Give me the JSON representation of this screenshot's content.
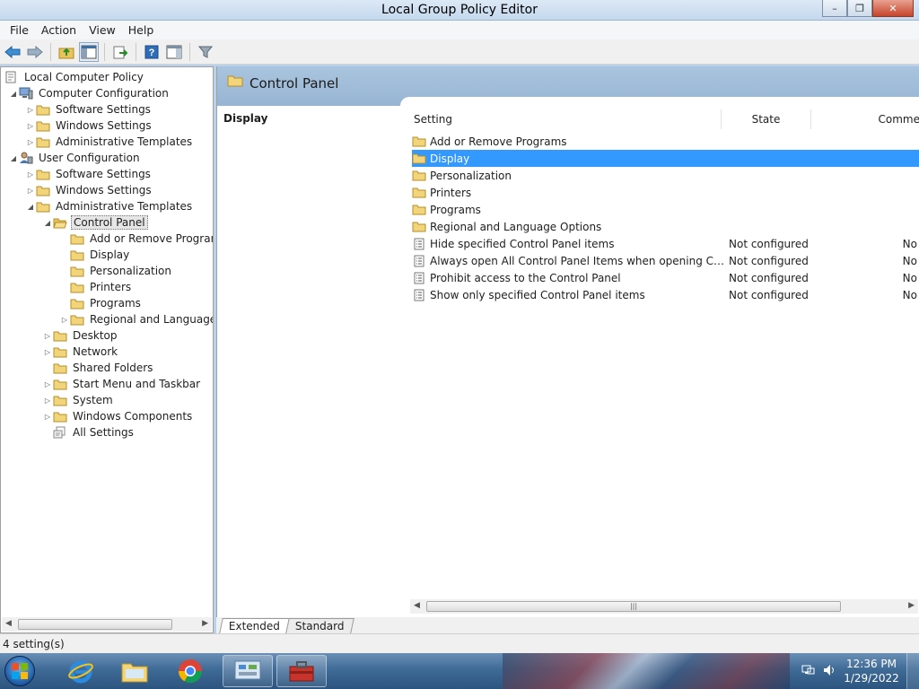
{
  "window": {
    "title": "Local Group Policy Editor",
    "minimize": "–",
    "restore": "❐",
    "close": "✕"
  },
  "menu": [
    "File",
    "Action",
    "View",
    "Help"
  ],
  "toolbar": {
    "icons": [
      "back-arrow-icon",
      "forward-arrow-icon",
      "up-folder-icon",
      "show-hide-tree-icon",
      "export-list-icon",
      "help-icon",
      "properties-pane-icon",
      "filter-icon"
    ]
  },
  "tree": [
    {
      "label": "Local Computer Policy",
      "level": 0,
      "expander": "",
      "icon": "policy"
    },
    {
      "label": "Computer Configuration",
      "level": 1,
      "expander": "◢",
      "icon": "computer"
    },
    {
      "label": "Software Settings",
      "level": 2,
      "expander": "▷",
      "icon": "folder"
    },
    {
      "label": "Windows Settings",
      "level": 2,
      "expander": "▷",
      "icon": "folder"
    },
    {
      "label": "Administrative Templates",
      "level": 2,
      "expander": "▷",
      "icon": "folder"
    },
    {
      "label": "User Configuration",
      "level": 1,
      "expander": "◢",
      "icon": "user"
    },
    {
      "label": "Software Settings",
      "level": 2,
      "expander": "▷",
      "icon": "folder"
    },
    {
      "label": "Windows Settings",
      "level": 2,
      "expander": "▷",
      "icon": "folder"
    },
    {
      "label": "Administrative Templates",
      "level": 2,
      "expander": "◢",
      "icon": "folder"
    },
    {
      "label": "Control Panel",
      "level": 3,
      "expander": "◢",
      "icon": "folder-open",
      "selected": true
    },
    {
      "label": "Add or Remove Programs",
      "level": 4,
      "expander": "",
      "icon": "folder"
    },
    {
      "label": "Display",
      "level": 4,
      "expander": "",
      "icon": "folder"
    },
    {
      "label": "Personalization",
      "level": 4,
      "expander": "",
      "icon": "folder"
    },
    {
      "label": "Printers",
      "level": 4,
      "expander": "",
      "icon": "folder"
    },
    {
      "label": "Programs",
      "level": 4,
      "expander": "",
      "icon": "folder"
    },
    {
      "label": "Regional and Language C",
      "level": 4,
      "expander": "▷",
      "icon": "folder"
    },
    {
      "label": "Desktop",
      "level": 3,
      "expander": "▷",
      "icon": "folder"
    },
    {
      "label": "Network",
      "level": 3,
      "expander": "▷",
      "icon": "folder"
    },
    {
      "label": "Shared Folders",
      "level": 3,
      "expander": "",
      "icon": "folder"
    },
    {
      "label": "Start Menu and Taskbar",
      "level": 3,
      "expander": "▷",
      "icon": "folder"
    },
    {
      "label": "System",
      "level": 3,
      "expander": "▷",
      "icon": "folder"
    },
    {
      "label": "Windows Components",
      "level": 3,
      "expander": "▷",
      "icon": "folder"
    },
    {
      "label": "All Settings",
      "level": 3,
      "expander": "",
      "icon": "settings"
    }
  ],
  "pane": {
    "title": "Control Panel",
    "description_heading": "Display",
    "columns": {
      "setting": "Setting",
      "state": "State",
      "comment": "Comme"
    },
    "rows": [
      {
        "name": "Add or Remove Programs",
        "state": "",
        "comment": "",
        "icon": "folder"
      },
      {
        "name": "Display",
        "state": "",
        "comment": "",
        "icon": "folder",
        "selected": true
      },
      {
        "name": "Personalization",
        "state": "",
        "comment": "",
        "icon": "folder"
      },
      {
        "name": "Printers",
        "state": "",
        "comment": "",
        "icon": "folder"
      },
      {
        "name": "Programs",
        "state": "",
        "comment": "",
        "icon": "folder"
      },
      {
        "name": "Regional and Language Options",
        "state": "",
        "comment": "",
        "icon": "folder"
      },
      {
        "name": "Hide specified Control Panel items",
        "state": "Not configured",
        "comment": "No",
        "icon": "setting"
      },
      {
        "name": "Always open All Control Panel Items when opening Control ...",
        "state": "Not configured",
        "comment": "No",
        "icon": "setting"
      },
      {
        "name": "Prohibit access to the Control Panel",
        "state": "Not configured",
        "comment": "No",
        "icon": "setting"
      },
      {
        "name": "Show only specified Control Panel items",
        "state": "Not configured",
        "comment": "No",
        "icon": "setting"
      }
    ]
  },
  "view_tabs": [
    "Extended",
    "Standard"
  ],
  "status": "4 setting(s)",
  "taskbar": {
    "apps": [
      "internet-explorer-icon",
      "file-explorer-icon",
      "chrome-icon",
      "control-panel-icon",
      "toolbox-icon"
    ],
    "time": "12:36 PM",
    "date": "1/29/2022"
  },
  "colors": {
    "selection": "#3399ff",
    "header": "#a9c4de",
    "taskbar": "#3f6b97"
  }
}
